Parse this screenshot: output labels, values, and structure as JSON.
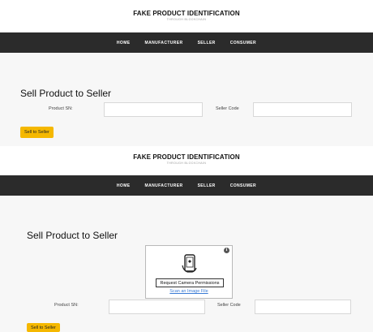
{
  "brand": {
    "title": "FAKE PRODUCT IDENTIFICATION",
    "subtitle": "THROUGH BLOCKCHAIN"
  },
  "nav": {
    "items": [
      "HOME",
      "MANUFACTURER",
      "SELLER",
      "CONSUMER"
    ]
  },
  "form": {
    "title": "Sell Product to Seller",
    "product_sn_label": "Product SN:",
    "seller_code_label": "Seller Code",
    "product_sn_value": "",
    "seller_code_value": "",
    "submit_label": "Sell to Seller"
  },
  "scanner": {
    "request_button": "Request Camera Permissions",
    "scan_image_link": "Scan an Image File",
    "info_icon": "info-icon",
    "camera_icon": "phone-camera-icon"
  },
  "colors": {
    "nav_bg": "#2b2b2b",
    "button_accent": "#f5b800",
    "link": "#3a7bd5"
  }
}
